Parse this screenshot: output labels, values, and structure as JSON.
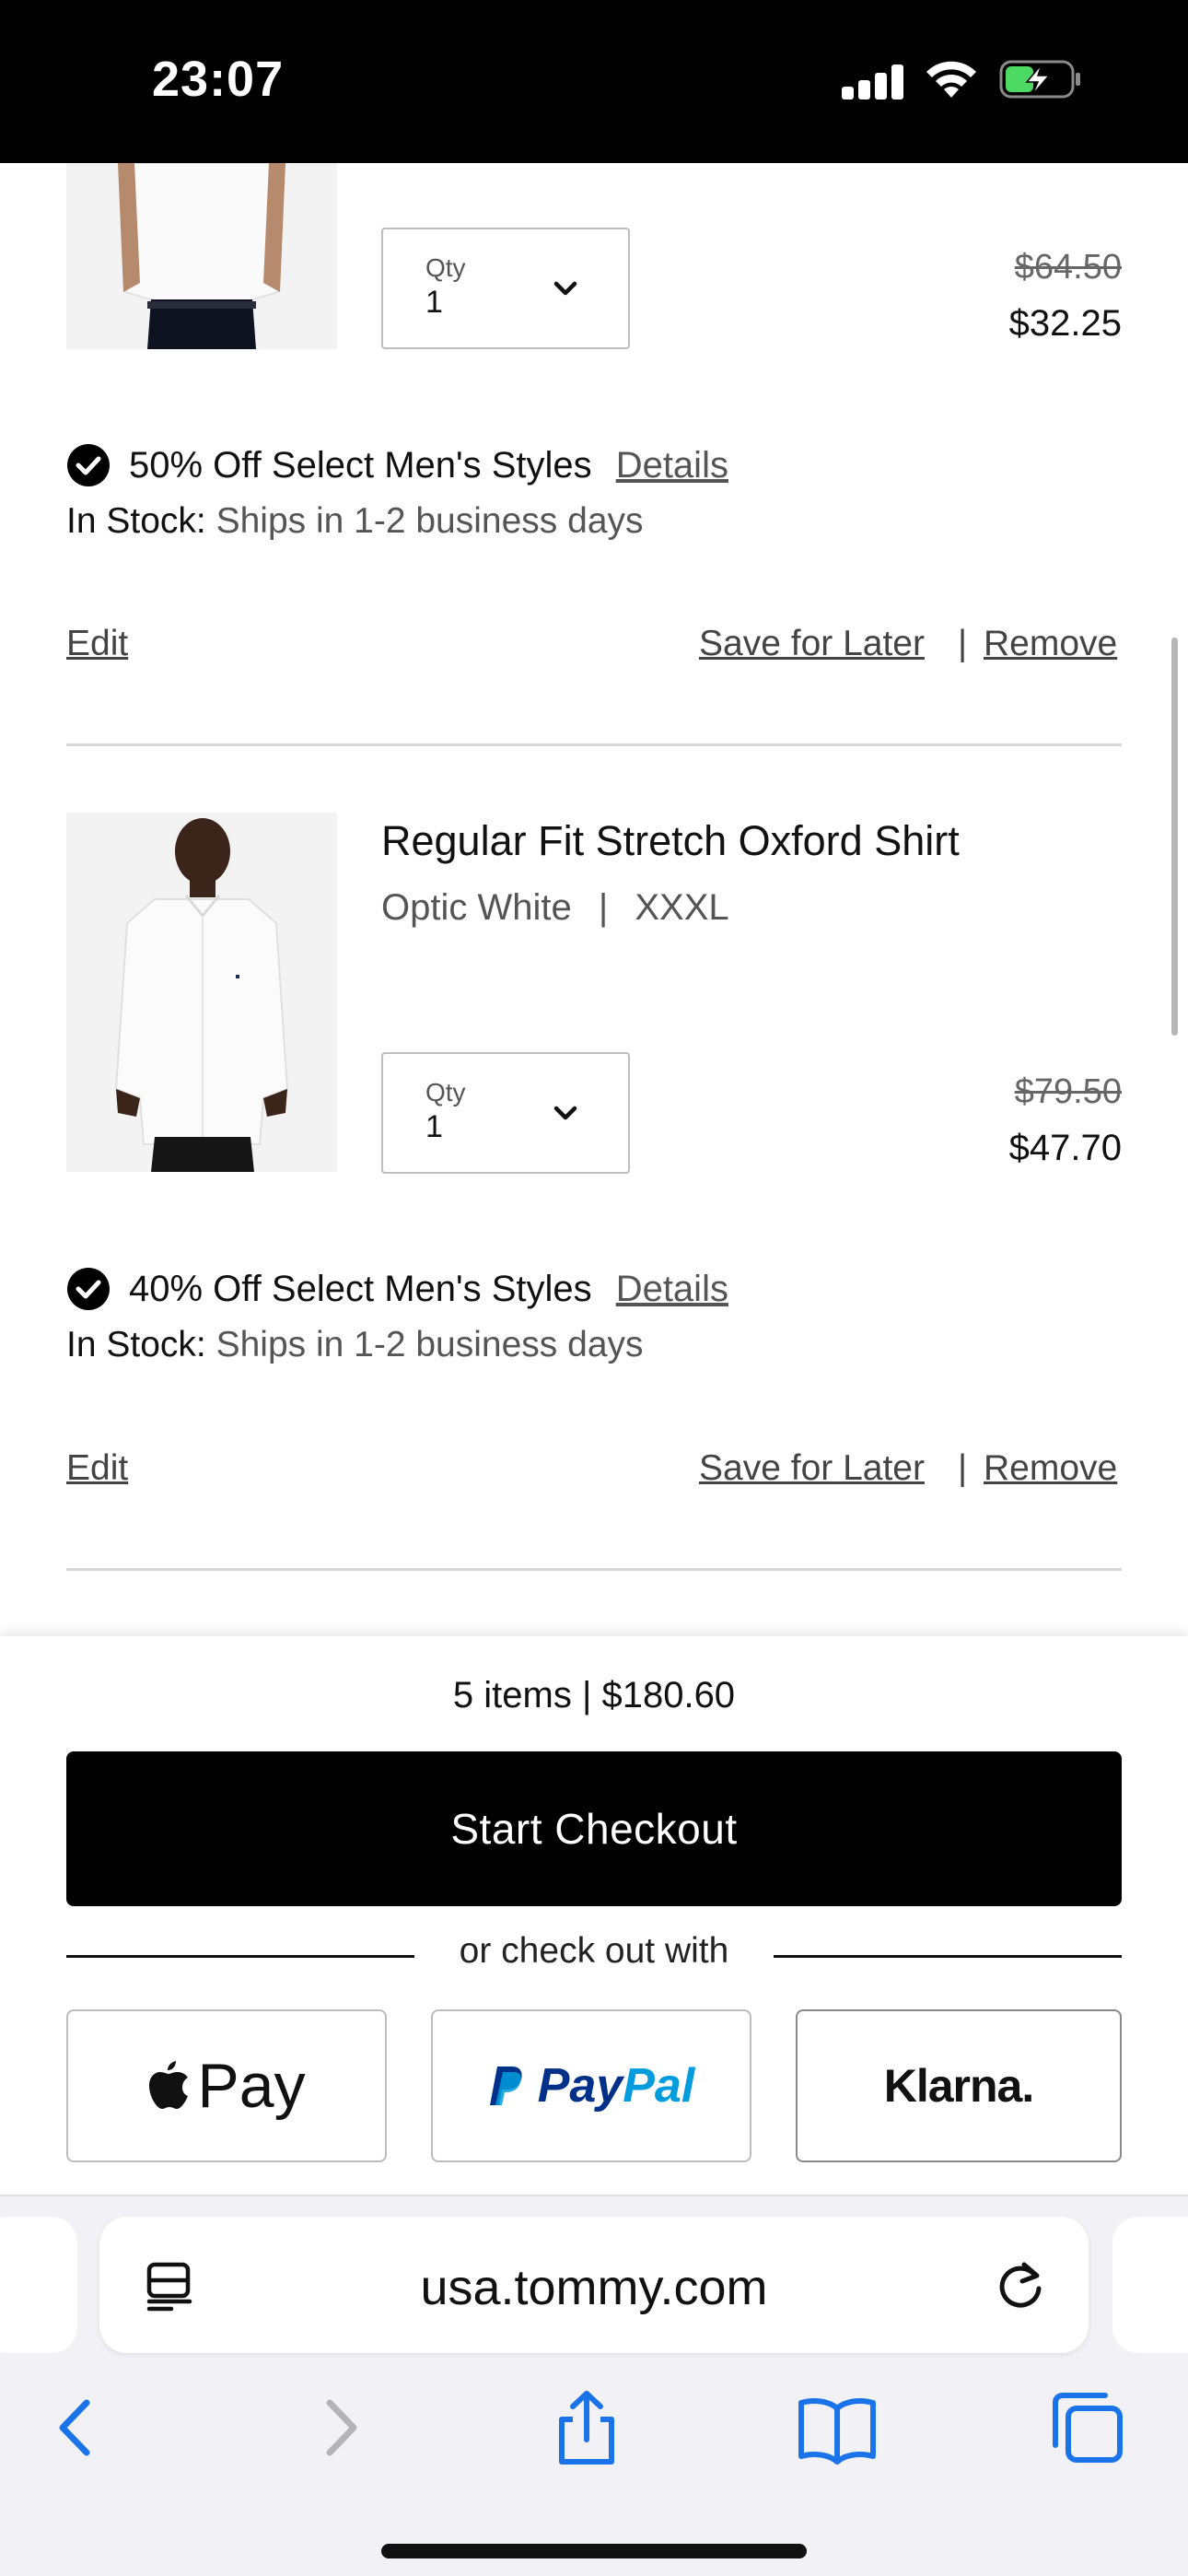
{
  "status_bar": {
    "time": "23:07"
  },
  "items": [
    {
      "qty_label": "Qty",
      "qty_value": "1",
      "original_price": "$64.50",
      "sale_price": "$32.25",
      "promo_text": "50% Off Select Men's Styles",
      "promo_details": "Details",
      "stock_label": "In Stock:",
      "stock_detail": "Ships in 1-2 business days",
      "edit": "Edit",
      "save_for_later": "Save for Later",
      "separator": "|",
      "remove": "Remove"
    },
    {
      "name": "Regular Fit Stretch Oxford Shirt",
      "color": "Optic White",
      "meta_separator": "|",
      "size": "XXXL",
      "qty_label": "Qty",
      "qty_value": "1",
      "original_price": "$79.50",
      "sale_price": "$47.70",
      "promo_text": "40% Off Select Men's Styles",
      "promo_details": "Details",
      "stock_label": "In Stock:",
      "stock_detail": "Ships in 1-2 business days",
      "edit": "Edit",
      "save_for_later": "Save for Later",
      "separator": "|",
      "remove": "Remove"
    }
  ],
  "checkout": {
    "summary": "5 items | $180.60",
    "start_checkout": "Start Checkout",
    "alt_label": "or check out with",
    "apple_pay": "Pay",
    "paypal_pay": "Pay",
    "paypal_pal": "Pal",
    "klarna": "Klarna."
  },
  "browser": {
    "url": "usa.tommy.com"
  },
  "colors": {
    "paypal_dark": "#003087",
    "paypal_light": "#009cde",
    "ios_blue": "#1a73e8",
    "ios_gray": "#b3b3b8"
  },
  "icons": [
    "chevron-down-icon",
    "checkmark-circle-icon",
    "apple-icon",
    "paypal-icon",
    "reader-mode-icon",
    "reload-icon",
    "back-icon",
    "forward-icon",
    "share-icon",
    "bookmarks-icon",
    "tabs-icon"
  ]
}
